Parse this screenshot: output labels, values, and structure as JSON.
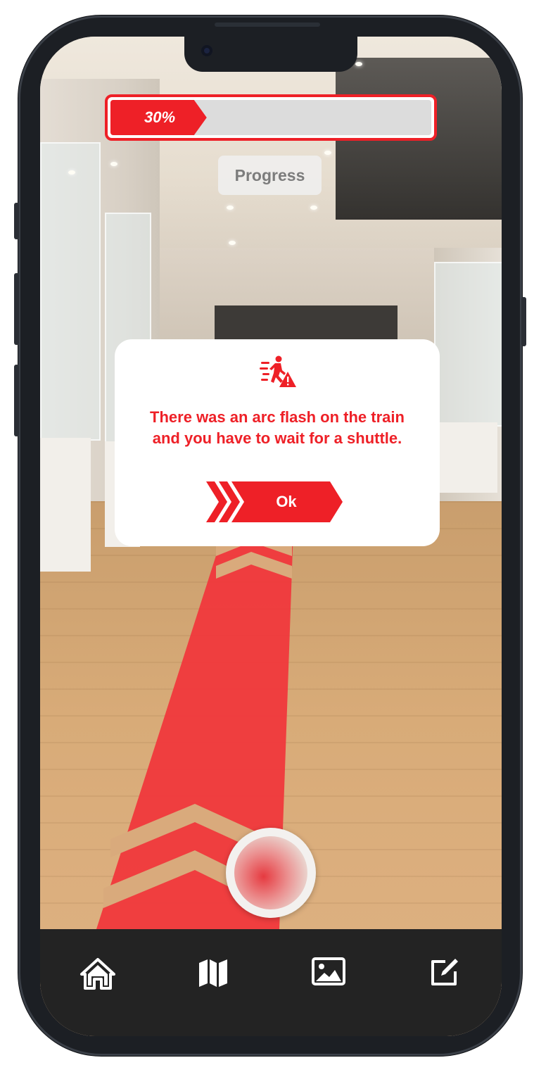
{
  "progress": {
    "value_text": "30%",
    "value_fraction": 0.3,
    "label": "Progress"
  },
  "dialog": {
    "icon": "person-running-warning-icon",
    "message": "There was an arc flash on the train and you have to wait for a shuttle.",
    "ok_label": "Ok"
  },
  "nav": {
    "items": [
      {
        "icon": "home-icon"
      },
      {
        "icon": "map-icon"
      },
      {
        "icon": "image-icon"
      },
      {
        "icon": "edit-icon"
      }
    ]
  },
  "colors": {
    "accent": "#ee2027",
    "navbar": "#232323",
    "progress_track": "#dcdcdc"
  }
}
